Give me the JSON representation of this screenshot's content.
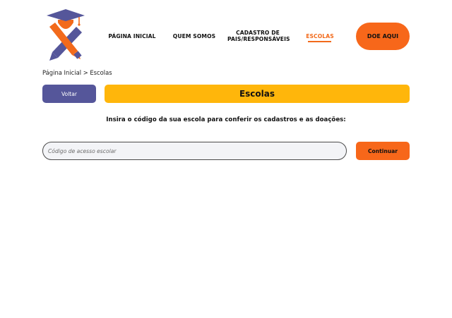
{
  "header": {
    "logo_icon": "graduation-cap-pencils-logo",
    "nav": {
      "home": "PÁGINA INICIAL",
      "about": "QUEM SOMOS",
      "register_line1": "CADASTRO DE",
      "register_line2": "PAIS/RESPONSÁVEIS",
      "schools": "ESCOLAS"
    },
    "donate_label": "DOE AQUI"
  },
  "breadcrumb": "Página Inicial > Escolas",
  "back_label": "Voltar",
  "title": "Escolas",
  "instruction": "Insira o código da sua escola para conferir os cadastros e as doações:",
  "form": {
    "code_placeholder": "Código de acesso escolar",
    "code_value": "",
    "continue_label": "Continuar"
  },
  "colors": {
    "accent_orange": "#f7671a",
    "accent_yellow": "#ffb60b",
    "accent_purple": "#55569a",
    "active_nav": "#f26a1b"
  }
}
